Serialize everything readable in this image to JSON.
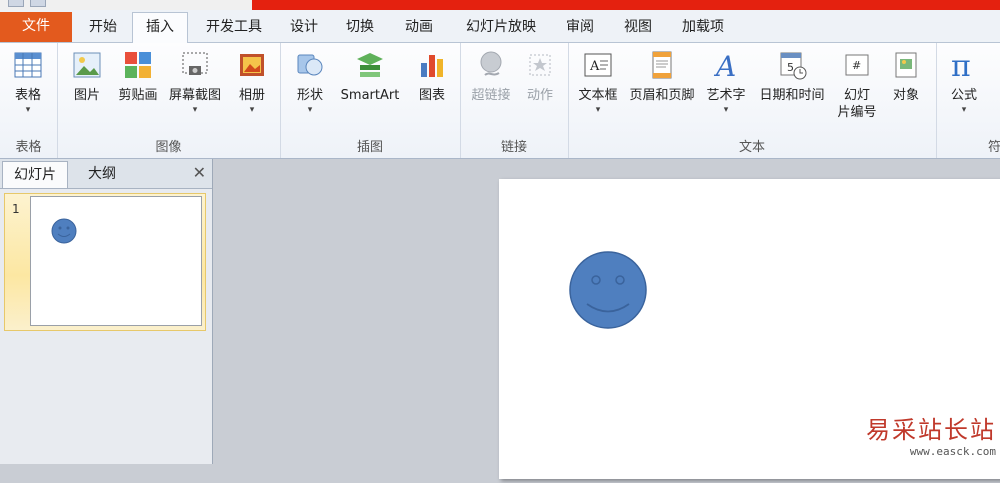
{
  "tabs": {
    "file": "文件",
    "home": "开始",
    "insert": "插入",
    "developer": "开发工具",
    "design": "设计",
    "transitions": "切换",
    "animations": "动画",
    "slideshow": "幻灯片放映",
    "review": "审阅",
    "view": "视图",
    "addins": "加载项"
  },
  "groups": {
    "tables": "表格",
    "images": "图像",
    "illustrations": "插图",
    "links": "链接",
    "text": "文本",
    "symbols": "符号"
  },
  "buttons": {
    "table": "表格",
    "picture": "图片",
    "clipart": "剪贴画",
    "screenshot": "屏幕截图",
    "album": "相册",
    "shapes": "形状",
    "smartart": "SmartArt",
    "chart": "图表",
    "hyperlink": "超链接",
    "action": "动作",
    "textbox": "文本框",
    "headerfooter": "页眉和页脚",
    "wordart": "艺术字",
    "datetime": "日期和时间",
    "slidenum1": "幻灯",
    "slidenum2": "片编号",
    "object": "对象",
    "equation": "公式"
  },
  "pane": {
    "tab_slides": "幻灯片",
    "tab_outline": "大纲",
    "close": "✕",
    "slide_number": "1"
  },
  "colors": {
    "file_tab": "#e35a1e",
    "title_red": "#e4210f",
    "smiley_fill": "#4f7fbf",
    "smiley_stroke": "#3a639c"
  },
  "watermark": {
    "title": "易采站长站",
    "url": "www.easck.com"
  }
}
